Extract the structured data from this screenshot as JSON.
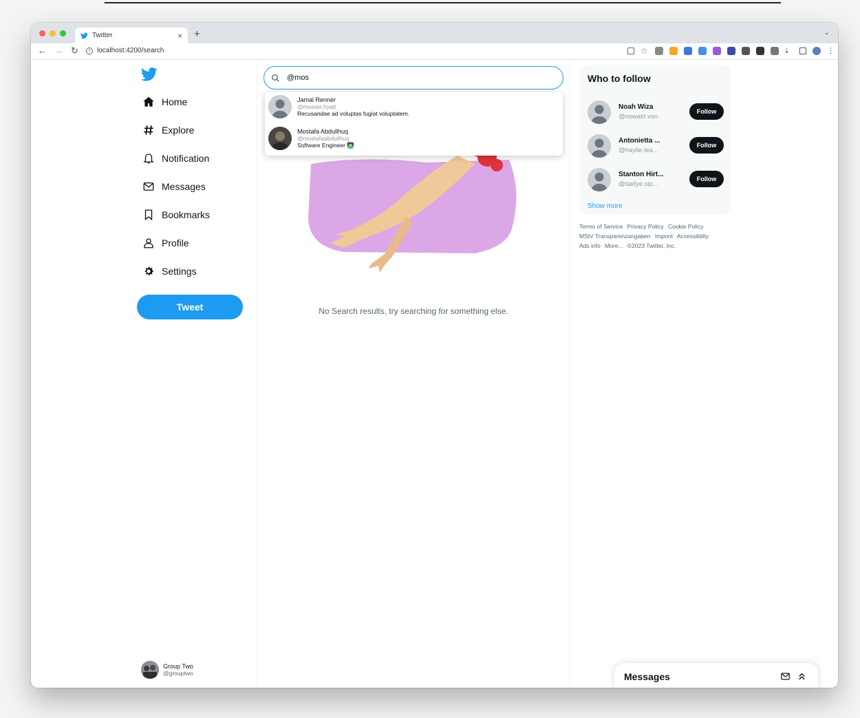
{
  "browser": {
    "tab_title": "Twitter",
    "tab_close": "×",
    "new_tab": "+",
    "url": "localhost:4200/search"
  },
  "sidebar": {
    "items": [
      {
        "label": "Home",
        "icon": "home-icon"
      },
      {
        "label": "Explore",
        "icon": "hashtag-icon"
      },
      {
        "label": "Notification",
        "icon": "bell-icon"
      },
      {
        "label": "Messages",
        "icon": "envelope-icon"
      },
      {
        "label": "Bookmarks",
        "icon": "bookmark-icon"
      },
      {
        "label": "Profile",
        "icon": "user-icon"
      },
      {
        "label": "Settings",
        "icon": "gear-icon"
      }
    ],
    "tweet_label": "Tweet",
    "account": {
      "name": "Group Two",
      "handle": "@grouptwo"
    }
  },
  "search": {
    "value": "@mos",
    "results": [
      {
        "name": "Jamal Renner",
        "handle": "@mossie.hyatt",
        "bio": "Recusandae ad voluptas fugiat voluptatem."
      },
      {
        "name": "Mostafa Abdullhuq",
        "handle": "@mostafaabdullhuq",
        "bio": "Software Engineer 👨‍💻"
      }
    ]
  },
  "main": {
    "empty_message": "No Search results, try searching for something else."
  },
  "who_to_follow": {
    "title": "Who to follow",
    "users": [
      {
        "name": "Noah Wiza",
        "handle": "@oswald.von"
      },
      {
        "name": "Antonietta ...",
        "handle": "@haylie.lea..."
      },
      {
        "name": "Stanton Hirt...",
        "handle": "@sadye.sip..."
      }
    ],
    "follow_label": "Follow",
    "show_more": "Show more"
  },
  "footer": {
    "links": [
      "Terms of Service",
      "Privacy Policy",
      "Cookie Policy",
      "MStV Transparenzangaben",
      "Imprint",
      "Accessibility",
      "Ads info",
      "More...",
      "©2023 Twitter, Inc."
    ]
  },
  "messages_drawer": {
    "title": "Messages"
  },
  "colors": {
    "accent": "#1d9bf0",
    "illustration_bg": "#dba7e6",
    "follow_button": "#0f1419"
  }
}
